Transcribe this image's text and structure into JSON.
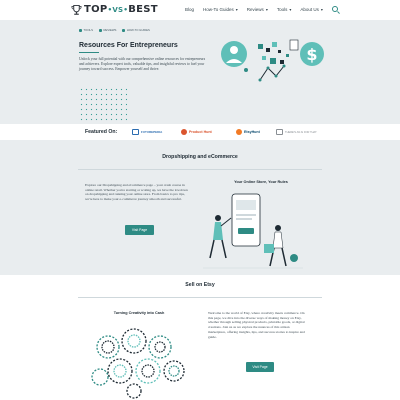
{
  "header": {
    "logo_top": "TOP",
    "logo_vs": "VS",
    "logo_best": "BEST",
    "nav": [
      {
        "label": "Blog",
        "dropdown": false
      },
      {
        "label": "How-To Guides",
        "dropdown": true
      },
      {
        "label": "Reviews",
        "dropdown": true
      },
      {
        "label": "Tools",
        "dropdown": true
      },
      {
        "label": "About Us",
        "dropdown": true
      }
    ],
    "search_icon": "search-icon"
  },
  "hero": {
    "breadcrumbs": [
      "TOOLS",
      "REVIEWS",
      "HOW-TO GUIDES"
    ],
    "title": "Resources For Entrepreneurs",
    "text": "Unlock your full potential with our comprehensive online resources for entrepreneurs and achievers. Explore expert tools, valuable tips, and insightful reviews to fuel your journey toward success. Empower yourself and thrive.",
    "accent_color": "#2e8b84"
  },
  "featured": {
    "label": "Featured On:",
    "logos": [
      "FUTUREPEDIA",
      "Product Hunt",
      "EtsyHunt",
      "THERE'S AN AI FOR THAT"
    ]
  },
  "dropshipping": {
    "title": "Dropshipping and eCommerce",
    "text": "Explore our Dropshipping and eCommerce page – your crash course in online retail. Whether you're starting or scaling up, we have the lowdown on dropshipping and running your online store. From basics to pro tips, we're here to make your e-commerce journey smooth and successful.",
    "button": "Visit Page",
    "illustration_title": "Your Online Store, Your Rules"
  },
  "etsy": {
    "title": "Sell on Etsy",
    "illustration_title": "Turning Creativity into Cash",
    "text": "Welcome to the world of Etsy, where creativity meets commerce. On this page, we dive into the diverse ways of making money on Etsy, whether through selling physical products, printable goods, or digital creations. Join us as we explore the nuances of this artisan marketplace, offering insights, tips, and success stories to inspire and guide.",
    "button": "Visit Page"
  }
}
